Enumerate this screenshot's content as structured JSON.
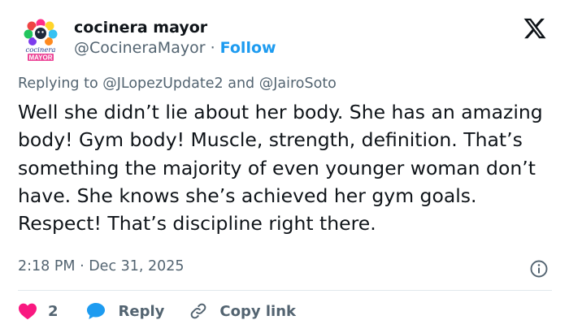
{
  "author": {
    "display_name": "cocinera mayor",
    "handle": "@CocineraMayor",
    "separator": "·",
    "follow_label": "Follow",
    "avatar_logo_lines": [
      "cocinera",
      "MAYOR"
    ]
  },
  "reply_context": {
    "prefix": "Replying to",
    "mention1": "@JLopezUpdate2",
    "conjunction": "and",
    "mention2": "@JairoSoto"
  },
  "tweet": {
    "text": "Well she didn’t lie about her body. She has an amazing body! Gym body! Muscle, strength, definition. That’s something the majority of even younger woman don’t have. She knows she’s achieved her gym goals. Respect! That’s discipline right there."
  },
  "meta": {
    "timestamp": "2:18 PM · Dec 31, 2025"
  },
  "actions": {
    "like_count": "2",
    "reply_label": "Reply",
    "copy_link_label": "Copy link"
  },
  "icons": {
    "brand_logo": "x-logo-icon",
    "like": "heart-icon",
    "reply": "speech-bubble-icon",
    "copy_link": "link-icon",
    "info": "info-icon"
  },
  "colors": {
    "text": "#0f1419",
    "secondary": "#536471",
    "accent": "#1d9bf0",
    "like": "#f91880"
  }
}
